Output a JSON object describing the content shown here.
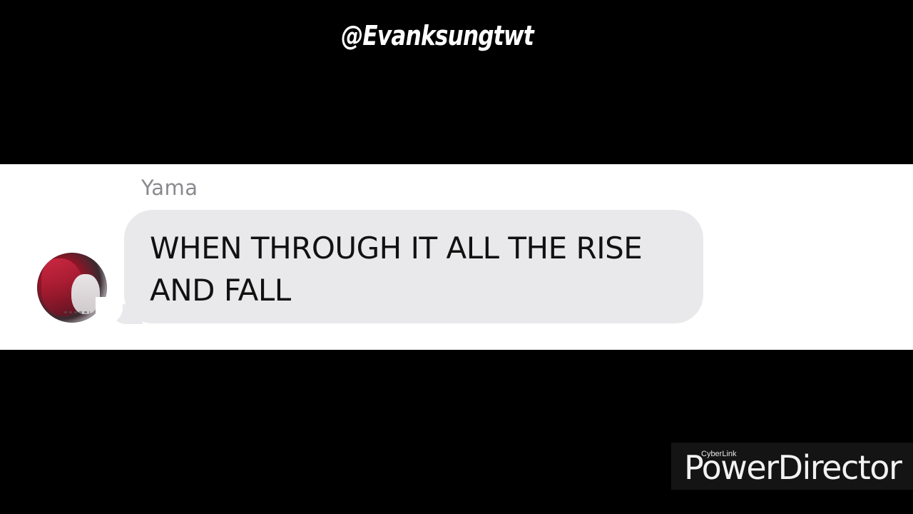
{
  "overlay": {
    "handle": "@Evanksungtwt"
  },
  "chat": {
    "sender_name": "Yama",
    "message": "WHEN THROUGH IT ALL THE RISE AND FALL",
    "bubble_color": "#e9e9eb",
    "sender_color": "#8a8a8e"
  },
  "watermark": {
    "brand_small": "CyberLink",
    "brand_big": "PowerDirector"
  },
  "colors": {
    "background": "#000000",
    "strip": "#ffffff"
  }
}
